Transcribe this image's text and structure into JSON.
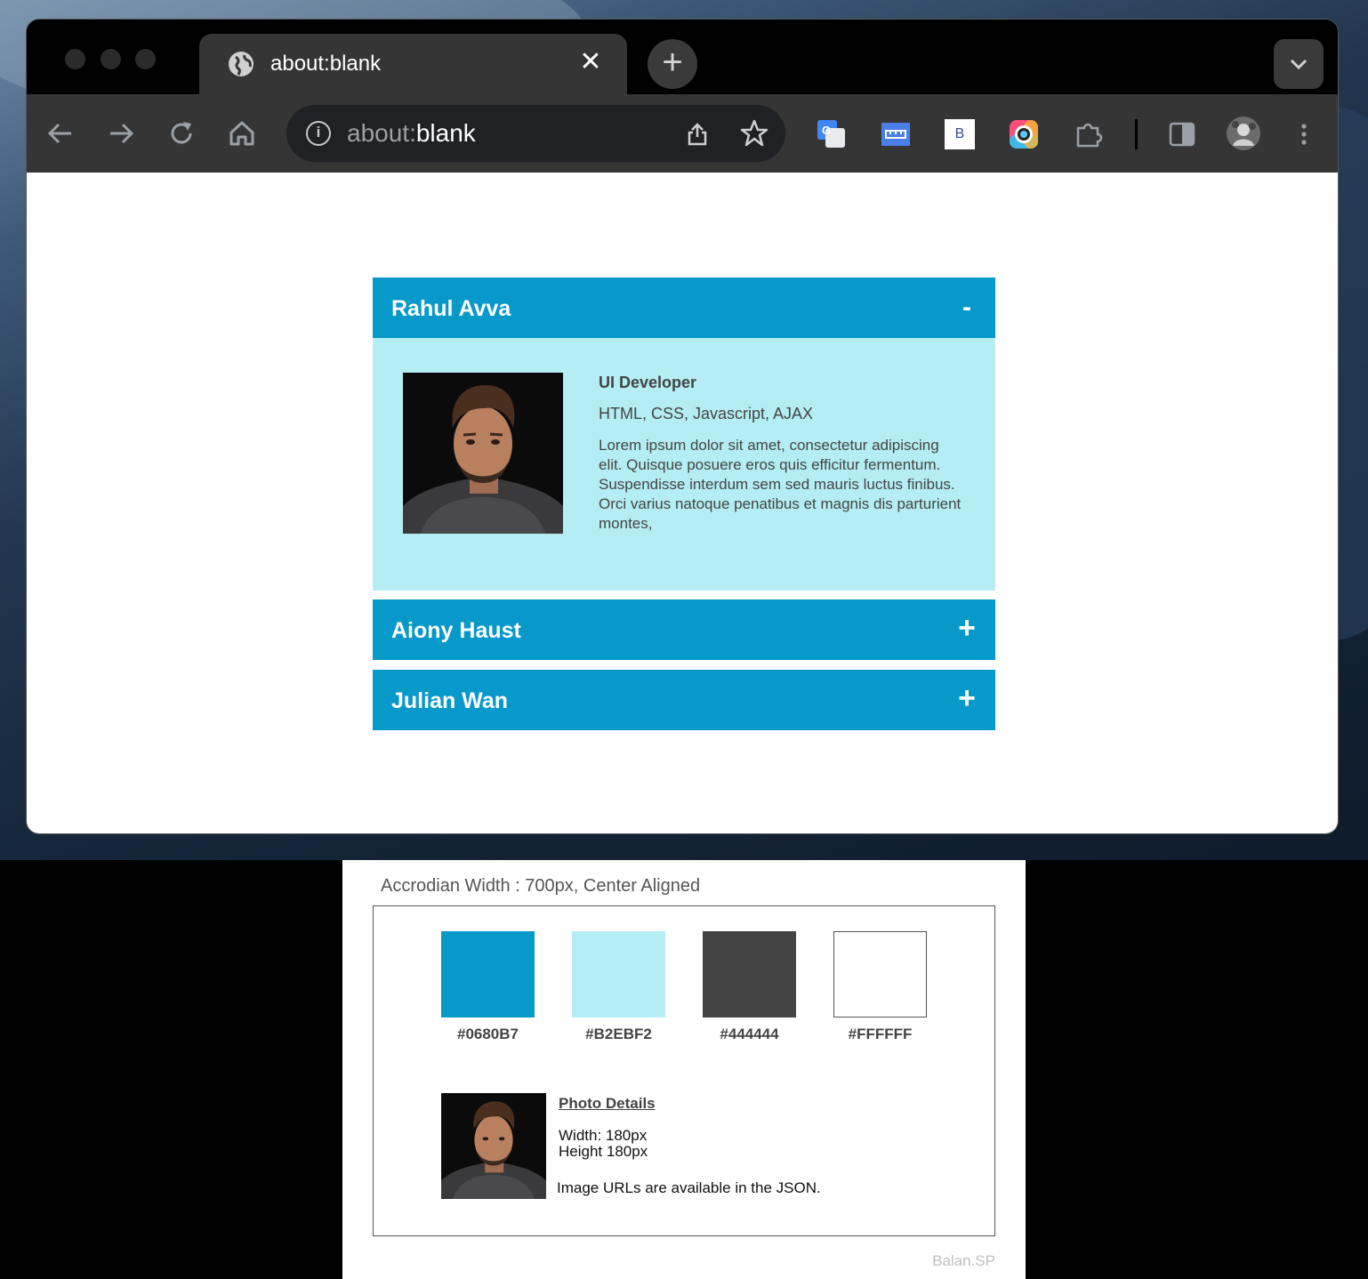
{
  "browser": {
    "tab_title": "about:blank",
    "tab_close": "✕",
    "new_tab": "+",
    "url_scheme": "about:",
    "url_path": "blank",
    "info_glyph": "i",
    "extension_bold_label": "B",
    "icons": [
      "back-icon",
      "forward-icon",
      "reload-icon",
      "home-icon",
      "share-icon",
      "star-icon",
      "translate-icon",
      "ruler-icon",
      "bold-extension-icon",
      "color-picker-icon",
      "extensions-icon",
      "side-panel-icon",
      "profile-avatar",
      "more-menu-icon",
      "tab-list-icon"
    ]
  },
  "accordion": {
    "items": [
      {
        "name": "Rahul Avva",
        "toggle": "-",
        "expanded": true,
        "role": "UI Developer",
        "skills": "HTML, CSS, Javascript, AJAX",
        "description": "Lorem ipsum dolor sit amet, consectetur adipiscing elit. Quisque posuere eros quis efficitur fermentum. Suspendisse interdum sem sed mauris luctus finibus. Orci varius natoque penatibus et magnis dis parturient montes,"
      },
      {
        "name": "Aiony Haust",
        "toggle": "+",
        "expanded": false
      },
      {
        "name": "Julian Wan",
        "toggle": "+",
        "expanded": false
      }
    ]
  },
  "spec": {
    "caption": "Accrodian Width : 700px, Center Aligned",
    "swatches": [
      {
        "hex": "#0680B7",
        "color": "#0699C9"
      },
      {
        "hex": "#B2EBF2",
        "color": "#B4EEF4"
      },
      {
        "hex": "#444444",
        "color": "#444444"
      },
      {
        "hex": "#FFFFFF",
        "color": "#FFFFFF"
      }
    ],
    "photo_details_title": "Photo Details",
    "width_line": "Width: 180px",
    "height_line": "Height 180px",
    "urls_note": "Image URLs are available in the JSON.",
    "credit": "Balan.SP"
  },
  "colors": {
    "header_blue": "#0699C9",
    "panel_cyan": "#B4EEF4",
    "text_gray": "#444444",
    "chrome_dark": "#353535"
  }
}
